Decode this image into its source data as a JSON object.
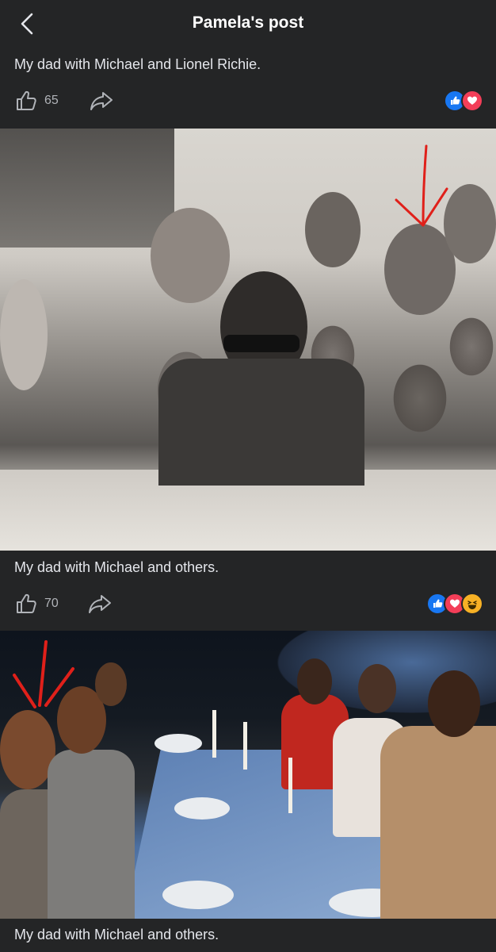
{
  "header": {
    "title": "Pamela's post",
    "back_icon": "chevron-left-icon"
  },
  "posts": [
    {
      "caption": "My dad with Michael and Lionel Richie.",
      "like_count": "65",
      "reactions": [
        "like",
        "love"
      ]
    },
    {
      "caption": "My dad with Michael and others.",
      "like_count": "70",
      "reactions": [
        "like",
        "love",
        "haha"
      ]
    },
    {
      "caption": "My dad with Michael and others."
    }
  ],
  "colors": {
    "background": "#242526",
    "text": "#e4e6eb",
    "like_blue": "#1877f2",
    "love_red": "#f33e58",
    "haha_yellow": "#f7b125",
    "annotation_red": "#e0201a"
  }
}
